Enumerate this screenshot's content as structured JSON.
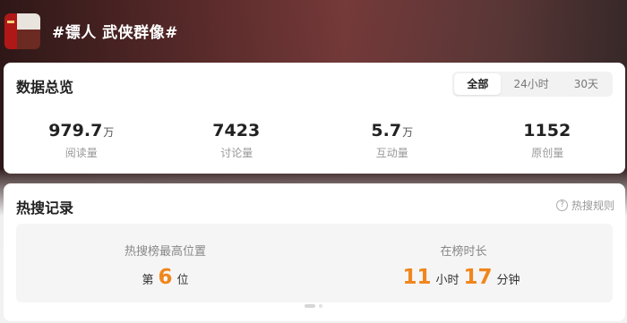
{
  "topic": {
    "title": "#镖人 武侠群像#"
  },
  "overview": {
    "title": "数据总览",
    "tabs": [
      {
        "label": "全部",
        "active": true
      },
      {
        "label": "24小时",
        "active": false
      },
      {
        "label": "30天",
        "active": false
      }
    ],
    "stats": [
      {
        "value": "979.7",
        "unit": "万",
        "label": "阅读量"
      },
      {
        "value": "7423",
        "unit": "",
        "label": "讨论量"
      },
      {
        "value": "5.7",
        "unit": "万",
        "label": "互动量"
      },
      {
        "value": "1152",
        "unit": "",
        "label": "原创量"
      }
    ]
  },
  "hot_record": {
    "title": "热搜记录",
    "rules_link": "热搜规则",
    "highest_position": {
      "label": "热搜榜最高位置",
      "prefix": "第",
      "value": "6",
      "suffix": "位"
    },
    "duration": {
      "label": "在榜时长",
      "hours": "11",
      "hours_unit": "小时",
      "minutes": "17",
      "minutes_unit": "分钟"
    }
  },
  "colors": {
    "accent": "#f0861c",
    "card_background": "#ffffff"
  }
}
